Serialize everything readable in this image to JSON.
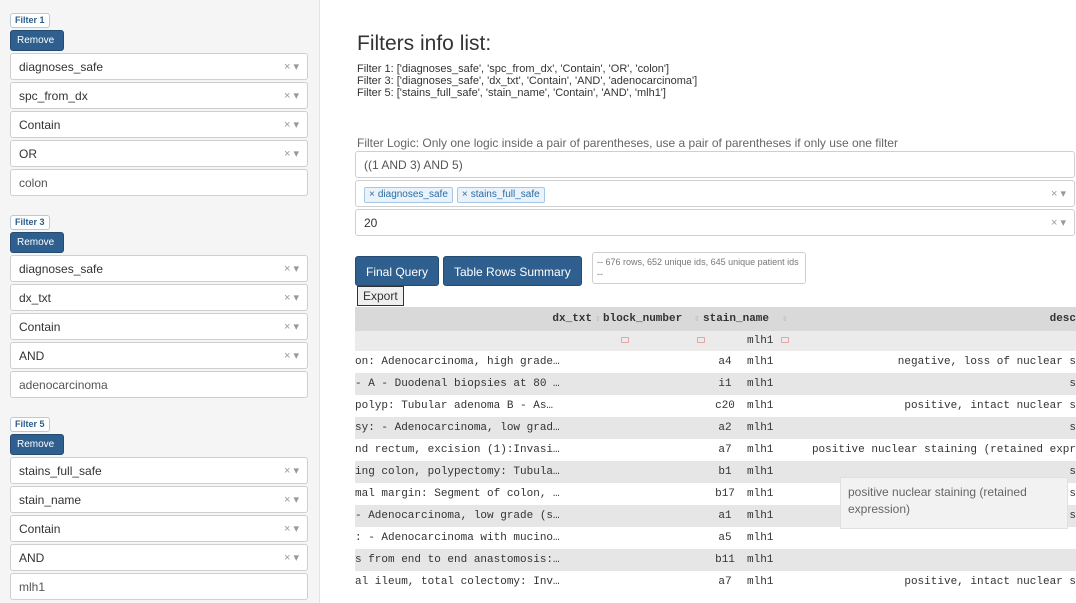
{
  "sidebar": {
    "filters": [
      {
        "label": "Filter 1",
        "remove_label": "Remove",
        "table": "diagnoses_safe",
        "column": "spc_from_dx",
        "operator": "Contain",
        "logic": "OR",
        "value": "colon"
      },
      {
        "label": "Filter 3",
        "remove_label": "Remove",
        "table": "diagnoses_safe",
        "column": "dx_txt",
        "operator": "Contain",
        "logic": "AND",
        "value": "adenocarcinoma"
      },
      {
        "label": "Filter 5",
        "remove_label": "Remove",
        "table": "stains_full_safe",
        "column": "stain_name",
        "operator": "Contain",
        "logic": "AND",
        "value": "mlh1"
      }
    ],
    "clear_glyph": "×",
    "caret_glyph": "▾"
  },
  "main": {
    "title": "Filters info list:",
    "info_lines": [
      "Filter 1: ['diagnoses_safe', 'spc_from_dx', 'Contain', 'OR', 'colon']",
      "Filter 3: ['diagnoses_safe', 'dx_txt', 'Contain', 'AND', 'adenocarcinoma']",
      "Filter 5: ['stains_full_safe', 'stain_name', 'Contain', 'AND', 'mlh1']"
    ],
    "logic_label": "Filter Logic: Only one logic inside a pair of parentheses, use a pair of parentheses if only use one filter",
    "logic_value": "((1 AND 3) AND 5)",
    "tables_selected": [
      "diagnoses_safe",
      "stains_full_safe"
    ],
    "row_limit": "20",
    "final_query_label": "Final Query",
    "table_rows_summary_label": "Table Rows Summary",
    "summary_text": "-- 676 rows, 652 unique ids, 645 unique patient ids --",
    "export_label": "Export"
  },
  "table": {
    "headers": {
      "dx_txt": "dx_txt",
      "block_number": "block_number",
      "stain_name": "stain_name",
      "desc": "desc"
    },
    "filter_row_stain": "mlh1",
    "rows": [
      {
        "dx_txt": "on: Adenocarcinoma, high grade…",
        "block_number": "a4",
        "stain_name": "mlh1",
        "desc": "negative, loss of nuclear s"
      },
      {
        "dx_txt": "- A - Duodenal biopsies at 80 …",
        "block_number": "i1",
        "stain_name": "mlh1",
        "desc": "s"
      },
      {
        "dx_txt": " polyp: Tubular adenoma B - As…",
        "block_number": "c20",
        "stain_name": "mlh1",
        "desc": "positive, intact nuclear s"
      },
      {
        "dx_txt": "sy: - Adenocarcinoma, low grad…",
        "block_number": "a2",
        "stain_name": "mlh1",
        "desc": "s"
      },
      {
        "dx_txt": "nd rectum, excision (1):Invasi…",
        "block_number": "a7",
        "stain_name": "mlh1",
        "desc": "positive nuclear staining (retained expr"
      },
      {
        "dx_txt": "ing colon, polypectomy: Tubula…",
        "block_number": "b1",
        "stain_name": "mlh1",
        "desc": "s"
      },
      {
        "dx_txt": "mal margin: Segment of colon, …",
        "block_number": "b17",
        "stain_name": "mlh1",
        "desc": "s"
      },
      {
        "dx_txt": "- Adenocarcinoma, low grade (s…",
        "block_number": "a1",
        "stain_name": "mlh1",
        "desc": "s"
      },
      {
        "dx_txt": ": - Adenocarcinoma with mucino…",
        "block_number": "a5",
        "stain_name": "mlh1",
        "desc": ""
      },
      {
        "dx_txt": "s from end to end anastomosis:…",
        "block_number": "b11",
        "stain_name": "mlh1",
        "desc": ""
      },
      {
        "dx_txt": "al ileum, total colectomy: Inv…",
        "block_number": "a7",
        "stain_name": "mlh1",
        "desc": "positive, intact nuclear s"
      }
    ],
    "tooltip": "positive nuclear staining (retained expression)"
  },
  "colors": {
    "primary_button": "#2e5f8f",
    "row_alt": "#e6e6e6",
    "header_bg": "#d9d9d9",
    "tag_text": "#2b6ca3"
  }
}
